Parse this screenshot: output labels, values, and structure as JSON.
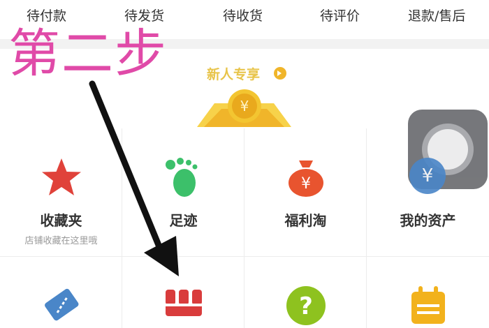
{
  "orders": [
    {
      "label": "待付款"
    },
    {
      "label": "待发货"
    },
    {
      "label": "待收货"
    },
    {
      "label": "待评价"
    },
    {
      "label": "退款/售后"
    }
  ],
  "step_title": "第二步",
  "promo": {
    "label": "新人专享",
    "coin_symbol": "¥"
  },
  "grid": {
    "row1": [
      {
        "label": "收藏夹",
        "sub": "店铺收藏在这里哦",
        "icon": "star-icon"
      },
      {
        "label": "足迹",
        "sub": "",
        "icon": "footprint-icon"
      },
      {
        "label": "福利淘",
        "sub": "",
        "icon": "money-bag-icon",
        "symbol": "¥"
      },
      {
        "label": "我的资产",
        "sub": "",
        "icon": "yen-coin-icon",
        "symbol": "¥"
      }
    ],
    "row2": [
      {
        "icon": "ticket-icon"
      },
      {
        "icon": "shop-icon"
      },
      {
        "icon": "help-icon",
        "symbol": "?"
      },
      {
        "icon": "calendar-icon"
      }
    ]
  },
  "colors": {
    "step_title": "#e04aa8",
    "promo": "#f0b52a",
    "star": "#e0423a",
    "footprint": "#3cc06a",
    "bag": "#e8542f",
    "asset": "#4a86c8",
    "ticket": "#4a86c8",
    "shop": "#d93c3c",
    "help": "#8ec21f",
    "calendar": "#f2b21c"
  }
}
